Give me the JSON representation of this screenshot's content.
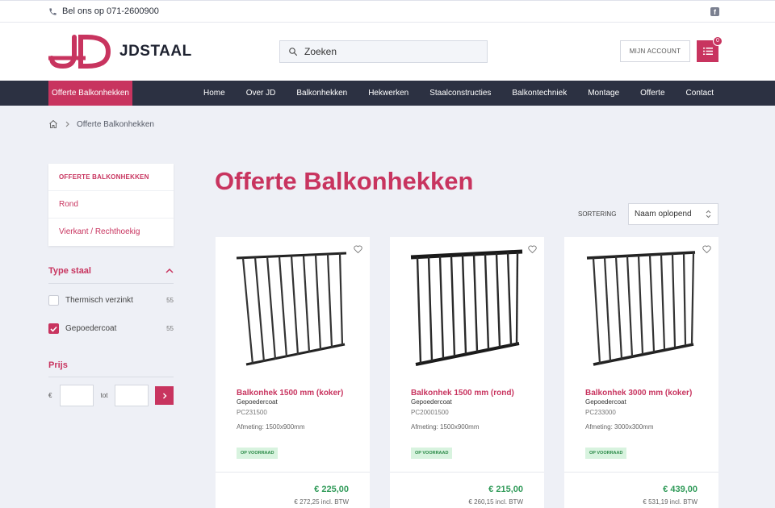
{
  "topbar": {
    "phone": "Bel ons op 071-2600900",
    "social_icon": "facebook-icon"
  },
  "header": {
    "logo_text": "JDSTAAL",
    "search_placeholder": "Zoeken",
    "account_label": "MIJN ACCOUNT",
    "cart_count": "0",
    "brand_color": "#c8345f"
  },
  "nav": {
    "active": "Offerte Balkonhekken",
    "links": [
      "Home",
      "Over JD",
      "Balkonhekken",
      "Hekwerken",
      "Staalconstructies",
      "Balkontechniek",
      "Montage",
      "Offerte",
      "Contact"
    ]
  },
  "breadcrumb": {
    "current": "Offerte Balkonhekken"
  },
  "sidebar": {
    "categories": [
      "OFFERTE BALKONHEKKEN",
      "Rond",
      "Vierkant / Rechthoekig"
    ],
    "type_title": "Type staal",
    "type_options": [
      {
        "label": "Thermisch verzinkt",
        "count": "55",
        "checked": false
      },
      {
        "label": "Gepoedercoat",
        "count": "55",
        "checked": true
      }
    ],
    "price_title": "Prijs",
    "price_from": "€",
    "price_to": "tot"
  },
  "main": {
    "title": "Offerte Balkonhekken",
    "sort_label": "SORTERING",
    "sort_value": "Naam oplopend"
  },
  "products": [
    {
      "name": "Balkonhek 1500 mm (koker)",
      "finish": "Gepoedercoat",
      "code": "PC231500",
      "dims": "Afmeting: 1500x900mm",
      "badge": "OP VOORRAAD",
      "price": "€ 225,00",
      "incl": "€ 272,25 incl. BTW"
    },
    {
      "name": "Balkonhek 1500 mm (rond)",
      "finish": "Gepoedercoat",
      "code": "PC20001500",
      "dims": "Afmeting: 1500x900mm",
      "badge": "OP VOORRAAD",
      "price": "€ 215,00",
      "incl": "€ 260,15 incl. BTW"
    },
    {
      "name": "Balkonhek 3000 mm (koker)",
      "finish": "Gepoedercoat",
      "code": "PC233000",
      "dims": "Afmeting: 3000x300mm",
      "badge": "OP VOORRAAD",
      "price": "€ 439,00",
      "incl": "€ 531,19 incl. BTW"
    }
  ]
}
